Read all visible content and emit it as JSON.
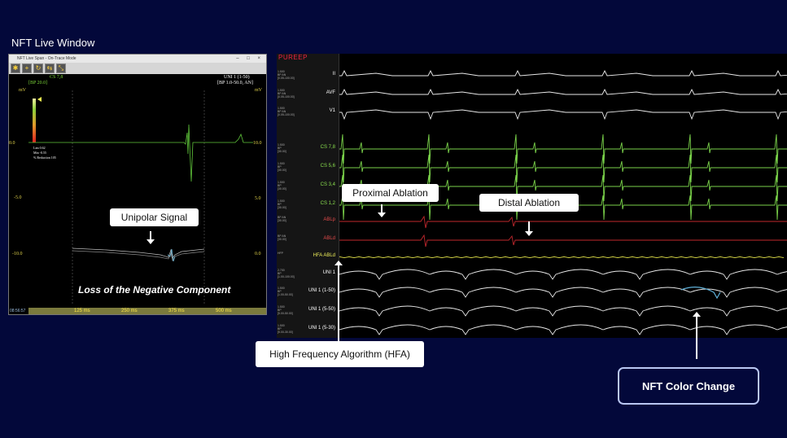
{
  "page": {
    "title": "NFT Live Window"
  },
  "nft_window": {
    "titlebar": "NFT Live Span - On-Trace Mode",
    "window_buttons": "– □ ×",
    "channel_name": "CS 7,8",
    "channel_filter": "[BP 20.0]",
    "channel_right_name": "UNI 1 (1-50)",
    "channel_right_filter": "[BP 1.0-50.0, AN]",
    "unit_left": "mV",
    "unit_right": "mV",
    "y_left_ticks": [
      "0.0",
      "-5.0",
      "-10.0"
    ],
    "y_right_ticks": [
      "10.0",
      "5.0",
      "0.0"
    ],
    "stats": [
      "Lim   0.62",
      "Min   -0.55",
      "% Reduction   105"
    ],
    "x_ticks": [
      "125 ms",
      "250 ms",
      "375 ms",
      "500 ms"
    ],
    "clock": "08:56:57",
    "toolbar_icons": [
      "gear-icon",
      "plus-icon",
      "refresh-icon",
      "arrows-icon",
      "arrows-diag-icon"
    ],
    "colors": {
      "bar_top": "#f0f0a0",
      "bar_bottom": "#e02020"
    }
  },
  "ep_recording": {
    "logo": "PUREEP",
    "rows": [
      {
        "label": "II",
        "meta": [
          "1.500",
          "BP    AN",
          "[0.05-100.00]"
        ],
        "color": "white"
      },
      {
        "label": "AVF",
        "meta": [
          "1.500",
          "BP    AN",
          "[0.05-100.00]"
        ],
        "color": "white"
      },
      {
        "label": "V1",
        "meta": [
          "1.500",
          "BP    AN",
          "[0.05-100.00]"
        ],
        "color": "white"
      },
      {
        "label": "CS 7,8",
        "meta": [
          "1.500",
          "BP",
          "[30.00]"
        ],
        "color": "green"
      },
      {
        "label": "CS 5,6",
        "meta": [
          "1.500",
          "BP",
          "[30.00]"
        ],
        "color": "green"
      },
      {
        "label": "CS 3,4",
        "meta": [
          "1.500",
          "BP",
          "[30.00]"
        ],
        "color": "green"
      },
      {
        "label": "CS 1,2",
        "meta": [
          "1.500",
          "BP",
          "[30.00]"
        ],
        "color": "green"
      },
      {
        "label": "ABLp",
        "meta": [
          "BP    AN",
          "[30.00]"
        ],
        "color": "red"
      },
      {
        "label": "ABLd",
        "meta": [
          "BP    AN",
          "[30.00]"
        ],
        "color": "red"
      },
      {
        "label": "HFA ABLd",
        "meta": [
          "HFP"
        ],
        "color": "yellow"
      },
      {
        "label": "UNI 1",
        "meta": [
          "2.700",
          "BP",
          "[1.00-100.00]"
        ],
        "color": "white"
      },
      {
        "label": "UNI 1 (1-50)",
        "meta": [
          "1.500",
          "BP",
          "[1.00-50.00]"
        ],
        "color": "white"
      },
      {
        "label": "UNI 1 (5-50)",
        "meta": [
          "1.500",
          "BP",
          "[5.00-50.00]"
        ],
        "color": "white"
      },
      {
        "label": "UNI 1 (5-30)",
        "meta": [
          "1.500",
          "BP",
          "[5.00-30.00]"
        ],
        "color": "white"
      }
    ]
  },
  "callouts": {
    "unipolar_signal": "Unipolar Signal",
    "loss_note": "Loss of the Negative Component",
    "proximal_ablation": "Proximal Ablation",
    "distal_ablation": "Distal Ablation",
    "hfa": "High Frequency Algorithm (HFA)",
    "nft_color_change": "NFT Color Change"
  }
}
